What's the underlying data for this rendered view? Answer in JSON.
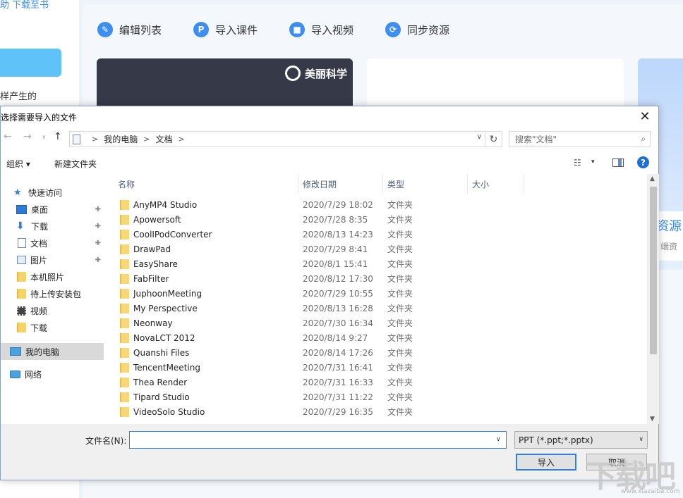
{
  "background": {
    "top_link": "助  下载至书",
    "desc": "样产生的",
    "toolbar": [
      {
        "label": "编辑列表",
        "icon": "edit-icon",
        "glyph": "✎"
      },
      {
        "label": "导入课件",
        "icon": "ppt-icon",
        "glyph": "P"
      },
      {
        "label": "导入视频",
        "icon": "video-icon",
        "glyph": "■"
      },
      {
        "label": "同步资源",
        "icon": "sync-icon",
        "glyph": "⟳"
      }
    ],
    "brand": "美丽科学",
    "side_text1": "资源",
    "side_text2": "端资"
  },
  "dialog": {
    "title": "选择需要导入的文件",
    "close_glyph": "✕",
    "address": {
      "crumbs": [
        "我的电脑",
        "文档"
      ],
      "sep": ">",
      "dropdown": "∨"
    },
    "refresh_glyph": "↻",
    "search_placeholder": "搜索\"文档\"",
    "search_glyph": "⌕",
    "command_bar": {
      "organize": "组织 ▾",
      "new_folder": "新建文件夹",
      "view_glyph": "☷",
      "view_dd": "▾",
      "help": "?"
    },
    "nav": [
      {
        "label": "快速访问",
        "icon": "star-icon",
        "pinned": false
      },
      {
        "label": "桌面",
        "icon": "desktop-icon",
        "pinned": true
      },
      {
        "label": "下载",
        "icon": "download-icon",
        "pinned": true
      },
      {
        "label": "文档",
        "icon": "document-icon",
        "pinned": true
      },
      {
        "label": "图片",
        "icon": "pictures-icon",
        "pinned": true
      },
      {
        "label": "本机照片",
        "icon": "folder-icon",
        "pinned": false
      },
      {
        "label": "待上传安装包",
        "icon": "folder-icon",
        "pinned": false
      },
      {
        "label": "视频",
        "icon": "video-folder-icon",
        "pinned": false
      },
      {
        "label": "下载",
        "icon": "folder-icon",
        "pinned": false
      },
      {
        "label": "我的电脑",
        "icon": "computer-icon",
        "pinned": false,
        "selected": true
      },
      {
        "label": "网络",
        "icon": "network-icon",
        "pinned": false
      }
    ],
    "columns": [
      "名称",
      "修改日期",
      "类型",
      "大小"
    ],
    "files": [
      {
        "name": "AnyMP4 Studio",
        "date": "2020/7/29 18:02",
        "type": "文件夹"
      },
      {
        "name": "Apowersoft",
        "date": "2020/7/28 8:35",
        "type": "文件夹"
      },
      {
        "name": "CoolIPodConverter",
        "date": "2020/8/13 14:23",
        "type": "文件夹"
      },
      {
        "name": "DrawPad",
        "date": "2020/7/29 8:41",
        "type": "文件夹"
      },
      {
        "name": "EasyShare",
        "date": "2020/8/1 15:41",
        "type": "文件夹"
      },
      {
        "name": "FabFilter",
        "date": "2020/8/12 17:30",
        "type": "文件夹"
      },
      {
        "name": "JuphoonMeeting",
        "date": "2020/7/29 10:55",
        "type": "文件夹"
      },
      {
        "name": "My Perspective",
        "date": "2020/8/13 16:28",
        "type": "文件夹"
      },
      {
        "name": "Neonway",
        "date": "2020/7/30 16:34",
        "type": "文件夹"
      },
      {
        "name": "NovaLCT 2012",
        "date": "2020/8/14 9:27",
        "type": "文件夹"
      },
      {
        "name": "Quanshi Files",
        "date": "2020/8/14 17:26",
        "type": "文件夹"
      },
      {
        "name": "TencentMeeting",
        "date": "2020/7/31 16:41",
        "type": "文件夹"
      },
      {
        "name": "Thea Render",
        "date": "2020/7/31 16:33",
        "type": "文件夹"
      },
      {
        "name": "Tipard Studio",
        "date": "2020/7/31 11:22",
        "type": "文件夹"
      },
      {
        "name": "VideoSolo Studio",
        "date": "2020/7/29 16:35",
        "type": "文件夹"
      }
    ],
    "filename_label": "文件名(N):",
    "filename_value": "",
    "filetype": "PPT (*.ppt;*.pptx)",
    "import_label": "导入",
    "cancel_label": "取消"
  },
  "watermark": {
    "text": "下载吧",
    "sub": "www.xiazaiba.com"
  },
  "colors": {
    "accent": "#3d8ef0",
    "dialog_border": "#8aa1c2",
    "selection": "#d9d9d9"
  }
}
